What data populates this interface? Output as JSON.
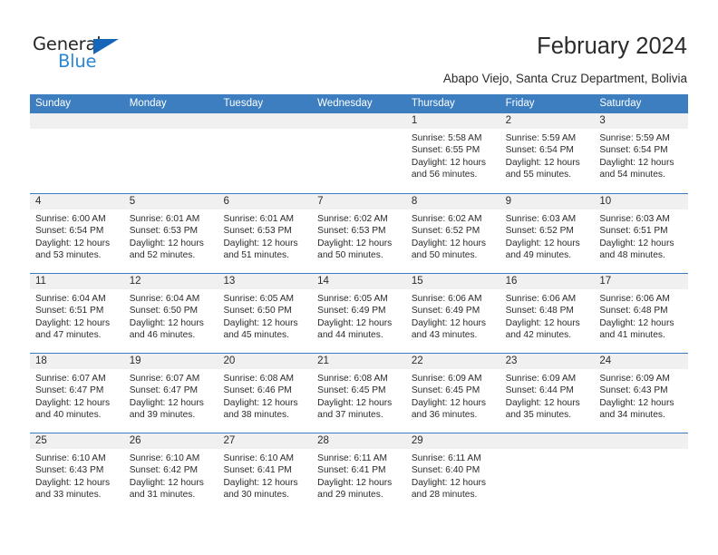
{
  "brand": {
    "name_primary": "General",
    "name_secondary": "Blue",
    "primary_color": "#262626",
    "accent_color": "#2b86d4",
    "triangle_color": "#1565b8"
  },
  "header": {
    "title": "February 2024",
    "subtitle": "Abapo Viejo, Santa Cruz Department, Bolivia",
    "header_bg_color": "#3c7ebf",
    "day_strip_color": "#f0f0f0"
  },
  "weekdays": [
    "Sunday",
    "Monday",
    "Tuesday",
    "Wednesday",
    "Thursday",
    "Friday",
    "Saturday"
  ],
  "weeks": [
    [
      {
        "day": "",
        "sunrise": "",
        "sunset": "",
        "daylight1": "",
        "daylight2": "",
        "empty": true
      },
      {
        "day": "",
        "sunrise": "",
        "sunset": "",
        "daylight1": "",
        "daylight2": "",
        "empty": true
      },
      {
        "day": "",
        "sunrise": "",
        "sunset": "",
        "daylight1": "",
        "daylight2": "",
        "empty": true
      },
      {
        "day": "",
        "sunrise": "",
        "sunset": "",
        "daylight1": "",
        "daylight2": "",
        "empty": true
      },
      {
        "day": "1",
        "sunrise": "Sunrise: 5:58 AM",
        "sunset": "Sunset: 6:55 PM",
        "daylight1": "Daylight: 12 hours",
        "daylight2": "and 56 minutes.",
        "empty": false
      },
      {
        "day": "2",
        "sunrise": "Sunrise: 5:59 AM",
        "sunset": "Sunset: 6:54 PM",
        "daylight1": "Daylight: 12 hours",
        "daylight2": "and 55 minutes.",
        "empty": false
      },
      {
        "day": "3",
        "sunrise": "Sunrise: 5:59 AM",
        "sunset": "Sunset: 6:54 PM",
        "daylight1": "Daylight: 12 hours",
        "daylight2": "and 54 minutes.",
        "empty": false
      }
    ],
    [
      {
        "day": "4",
        "sunrise": "Sunrise: 6:00 AM",
        "sunset": "Sunset: 6:54 PM",
        "daylight1": "Daylight: 12 hours",
        "daylight2": "and 53 minutes.",
        "empty": false
      },
      {
        "day": "5",
        "sunrise": "Sunrise: 6:01 AM",
        "sunset": "Sunset: 6:53 PM",
        "daylight1": "Daylight: 12 hours",
        "daylight2": "and 52 minutes.",
        "empty": false
      },
      {
        "day": "6",
        "sunrise": "Sunrise: 6:01 AM",
        "sunset": "Sunset: 6:53 PM",
        "daylight1": "Daylight: 12 hours",
        "daylight2": "and 51 minutes.",
        "empty": false
      },
      {
        "day": "7",
        "sunrise": "Sunrise: 6:02 AM",
        "sunset": "Sunset: 6:53 PM",
        "daylight1": "Daylight: 12 hours",
        "daylight2": "and 50 minutes.",
        "empty": false
      },
      {
        "day": "8",
        "sunrise": "Sunrise: 6:02 AM",
        "sunset": "Sunset: 6:52 PM",
        "daylight1": "Daylight: 12 hours",
        "daylight2": "and 50 minutes.",
        "empty": false
      },
      {
        "day": "9",
        "sunrise": "Sunrise: 6:03 AM",
        "sunset": "Sunset: 6:52 PM",
        "daylight1": "Daylight: 12 hours",
        "daylight2": "and 49 minutes.",
        "empty": false
      },
      {
        "day": "10",
        "sunrise": "Sunrise: 6:03 AM",
        "sunset": "Sunset: 6:51 PM",
        "daylight1": "Daylight: 12 hours",
        "daylight2": "and 48 minutes.",
        "empty": false
      }
    ],
    [
      {
        "day": "11",
        "sunrise": "Sunrise: 6:04 AM",
        "sunset": "Sunset: 6:51 PM",
        "daylight1": "Daylight: 12 hours",
        "daylight2": "and 47 minutes.",
        "empty": false
      },
      {
        "day": "12",
        "sunrise": "Sunrise: 6:04 AM",
        "sunset": "Sunset: 6:50 PM",
        "daylight1": "Daylight: 12 hours",
        "daylight2": "and 46 minutes.",
        "empty": false
      },
      {
        "day": "13",
        "sunrise": "Sunrise: 6:05 AM",
        "sunset": "Sunset: 6:50 PM",
        "daylight1": "Daylight: 12 hours",
        "daylight2": "and 45 minutes.",
        "empty": false
      },
      {
        "day": "14",
        "sunrise": "Sunrise: 6:05 AM",
        "sunset": "Sunset: 6:49 PM",
        "daylight1": "Daylight: 12 hours",
        "daylight2": "and 44 minutes.",
        "empty": false
      },
      {
        "day": "15",
        "sunrise": "Sunrise: 6:06 AM",
        "sunset": "Sunset: 6:49 PM",
        "daylight1": "Daylight: 12 hours",
        "daylight2": "and 43 minutes.",
        "empty": false
      },
      {
        "day": "16",
        "sunrise": "Sunrise: 6:06 AM",
        "sunset": "Sunset: 6:48 PM",
        "daylight1": "Daylight: 12 hours",
        "daylight2": "and 42 minutes.",
        "empty": false
      },
      {
        "day": "17",
        "sunrise": "Sunrise: 6:06 AM",
        "sunset": "Sunset: 6:48 PM",
        "daylight1": "Daylight: 12 hours",
        "daylight2": "and 41 minutes.",
        "empty": false
      }
    ],
    [
      {
        "day": "18",
        "sunrise": "Sunrise: 6:07 AM",
        "sunset": "Sunset: 6:47 PM",
        "daylight1": "Daylight: 12 hours",
        "daylight2": "and 40 minutes.",
        "empty": false
      },
      {
        "day": "19",
        "sunrise": "Sunrise: 6:07 AM",
        "sunset": "Sunset: 6:47 PM",
        "daylight1": "Daylight: 12 hours",
        "daylight2": "and 39 minutes.",
        "empty": false
      },
      {
        "day": "20",
        "sunrise": "Sunrise: 6:08 AM",
        "sunset": "Sunset: 6:46 PM",
        "daylight1": "Daylight: 12 hours",
        "daylight2": "and 38 minutes.",
        "empty": false
      },
      {
        "day": "21",
        "sunrise": "Sunrise: 6:08 AM",
        "sunset": "Sunset: 6:45 PM",
        "daylight1": "Daylight: 12 hours",
        "daylight2": "and 37 minutes.",
        "empty": false
      },
      {
        "day": "22",
        "sunrise": "Sunrise: 6:09 AM",
        "sunset": "Sunset: 6:45 PM",
        "daylight1": "Daylight: 12 hours",
        "daylight2": "and 36 minutes.",
        "empty": false
      },
      {
        "day": "23",
        "sunrise": "Sunrise: 6:09 AM",
        "sunset": "Sunset: 6:44 PM",
        "daylight1": "Daylight: 12 hours",
        "daylight2": "and 35 minutes.",
        "empty": false
      },
      {
        "day": "24",
        "sunrise": "Sunrise: 6:09 AM",
        "sunset": "Sunset: 6:43 PM",
        "daylight1": "Daylight: 12 hours",
        "daylight2": "and 34 minutes.",
        "empty": false
      }
    ],
    [
      {
        "day": "25",
        "sunrise": "Sunrise: 6:10 AM",
        "sunset": "Sunset: 6:43 PM",
        "daylight1": "Daylight: 12 hours",
        "daylight2": "and 33 minutes.",
        "empty": false
      },
      {
        "day": "26",
        "sunrise": "Sunrise: 6:10 AM",
        "sunset": "Sunset: 6:42 PM",
        "daylight1": "Daylight: 12 hours",
        "daylight2": "and 31 minutes.",
        "empty": false
      },
      {
        "day": "27",
        "sunrise": "Sunrise: 6:10 AM",
        "sunset": "Sunset: 6:41 PM",
        "daylight1": "Daylight: 12 hours",
        "daylight2": "and 30 minutes.",
        "empty": false
      },
      {
        "day": "28",
        "sunrise": "Sunrise: 6:11 AM",
        "sunset": "Sunset: 6:41 PM",
        "daylight1": "Daylight: 12 hours",
        "daylight2": "and 29 minutes.",
        "empty": false
      },
      {
        "day": "29",
        "sunrise": "Sunrise: 6:11 AM",
        "sunset": "Sunset: 6:40 PM",
        "daylight1": "Daylight: 12 hours",
        "daylight2": "and 28 minutes.",
        "empty": false
      },
      {
        "day": "",
        "sunrise": "",
        "sunset": "",
        "daylight1": "",
        "daylight2": "",
        "empty": true
      },
      {
        "day": "",
        "sunrise": "",
        "sunset": "",
        "daylight1": "",
        "daylight2": "",
        "empty": true
      }
    ]
  ]
}
